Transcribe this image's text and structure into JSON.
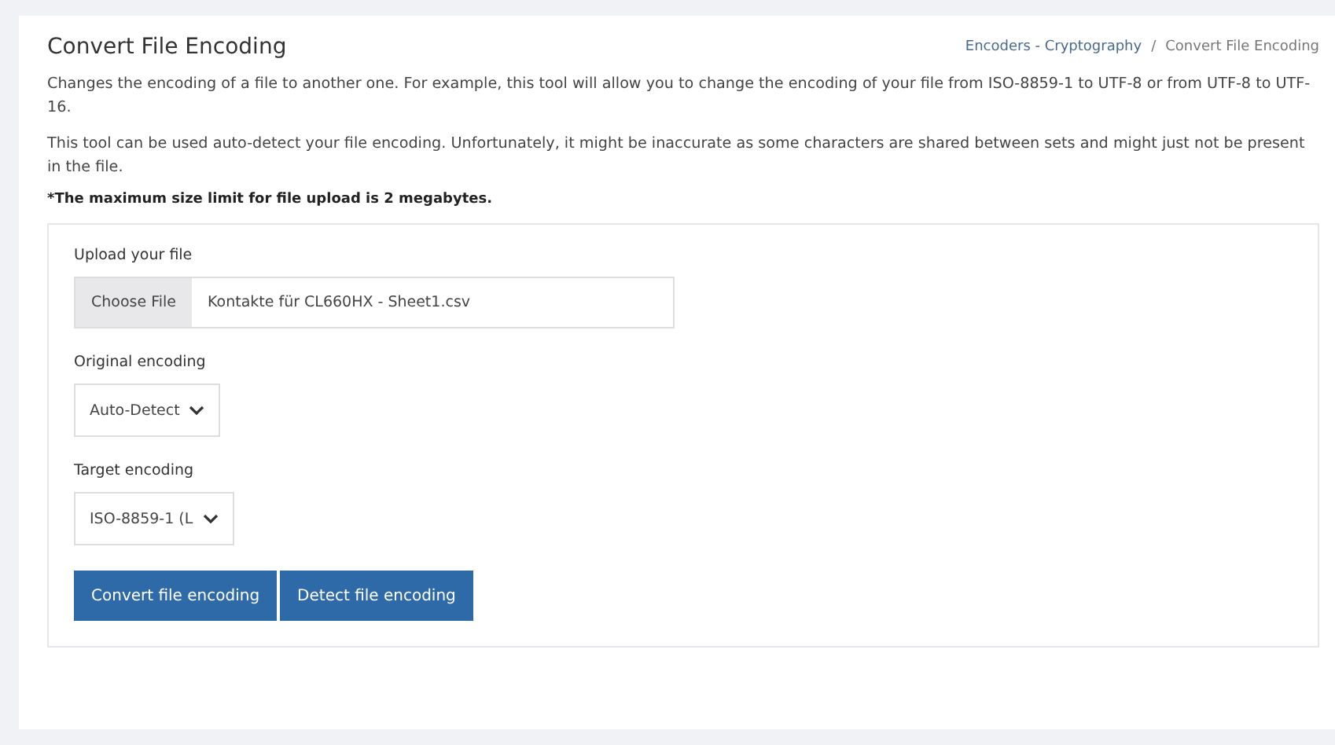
{
  "title": "Convert File Encoding",
  "breadcrumb": [
    {
      "label": "Encoders - Cryptography"
    },
    {
      "label": "Convert File Encoding"
    }
  ],
  "breadcrumb_separator": "/",
  "paragraphs": [
    "Changes the encoding of a file to another one. For example, this tool will allow you to change the encoding of your file from ISO-8859-1 to UTF-8 or from UTF-8 to UTF-16.",
    "This tool can be used auto-detect your file encoding. Unfortunately, it might be inaccurate as some characters are shared between sets and might just not be present in the file."
  ],
  "size_note": "*The maximum size limit for file upload is 2 megabytes.",
  "upload": {
    "label": "Upload your file",
    "button": "Choose File",
    "file_name": "Kontakte für CL660HX - Sheet1.csv"
  },
  "original_encoding": {
    "label": "Original encoding",
    "value": "Auto-Detect"
  },
  "target_encoding": {
    "label": "Target encoding",
    "value": "ISO-8859-1 (L"
  },
  "buttons": [
    "Convert file encoding",
    "Detect file encoding"
  ]
}
